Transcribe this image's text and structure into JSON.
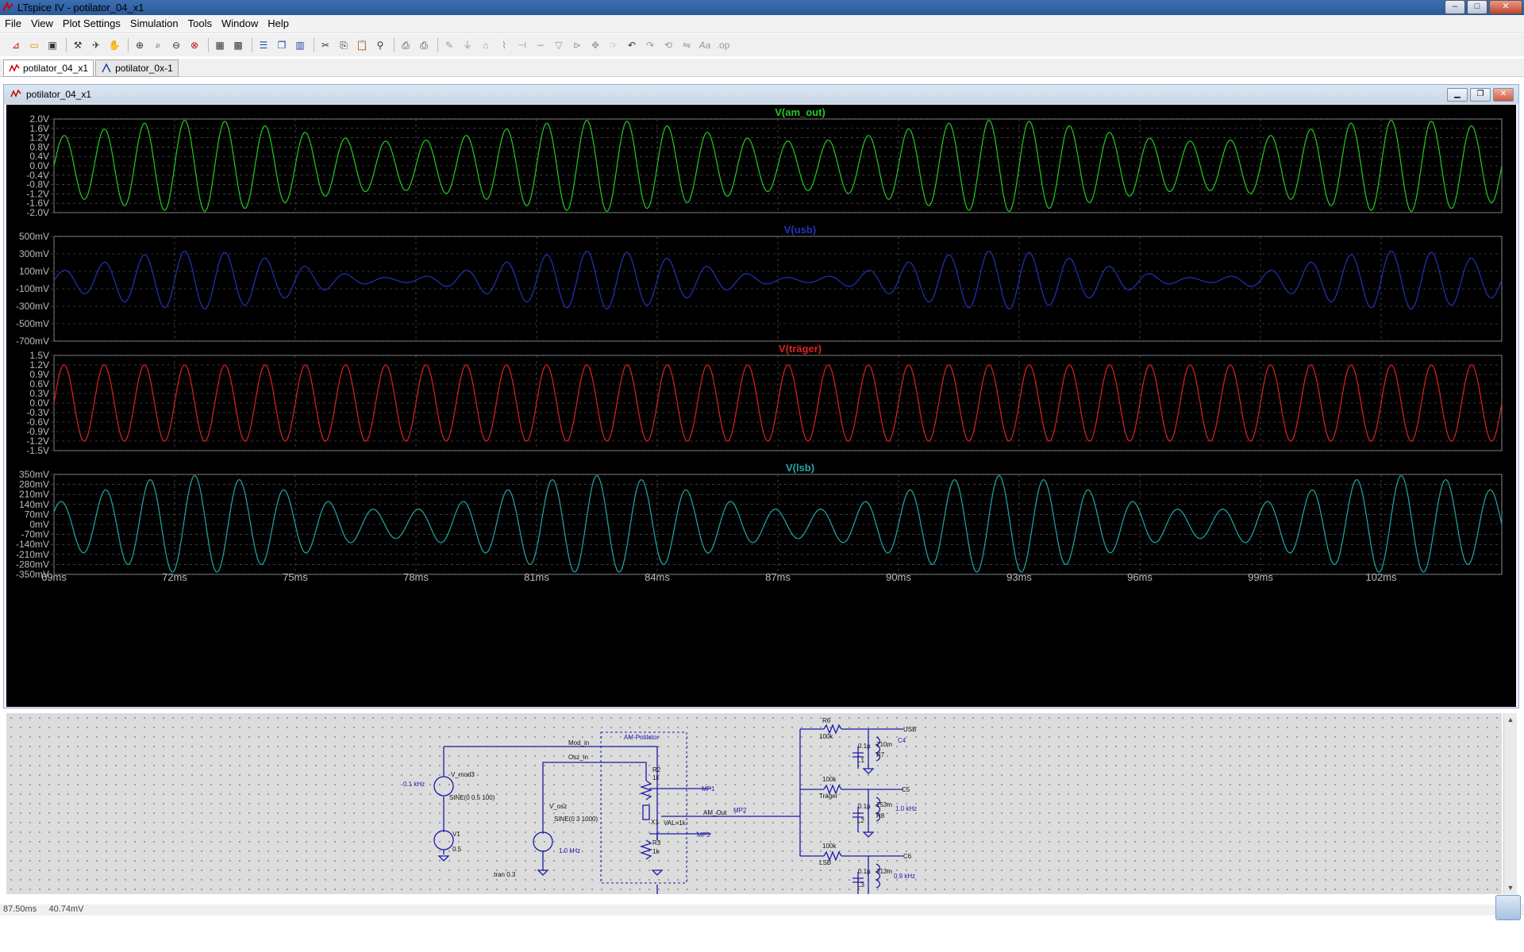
{
  "window": {
    "title": "LTspice IV - potilator_04_x1",
    "minimize": "–",
    "maximize": "□",
    "close": "✕"
  },
  "menu": [
    "File",
    "View",
    "Plot Settings",
    "Simulation",
    "Tools",
    "Window",
    "Help"
  ],
  "toolbar_icons": [
    "new-schematic-icon",
    "open-icon",
    "save-icon",
    "control-panel-icon",
    "run-icon",
    "pan-icon",
    "zoom-in-icon",
    "zoom-area-icon",
    "zoom-out-icon",
    "zoom-fit-icon",
    "autorange-icon",
    "mark-unused-icon",
    "tile-horizontal-icon",
    "cascade-icon",
    "tile-vertical-icon",
    "cut-icon",
    "copy-icon",
    "paste-icon",
    "find-icon",
    "print-setup-icon",
    "print-icon",
    "draw-wire-icon",
    "ground-icon",
    "label-icon",
    "resistor-icon",
    "capacitor-icon",
    "inductor-icon",
    "diode-icon",
    "component-icon",
    "move-icon",
    "drag-icon",
    "undo-icon",
    "redo-icon",
    "rotate-icon",
    "mirror-icon",
    "text-icon",
    "spice-directive-icon"
  ],
  "tabs": [
    {
      "label": "potilator_04_x1",
      "active": true
    },
    {
      "label": "potilator_0x-1",
      "active": false
    }
  ],
  "plot_window": {
    "title": "potilator_04_x1"
  },
  "x_axis": {
    "ticks": [
      "69ms",
      "72ms",
      "75ms",
      "78ms",
      "81ms",
      "84ms",
      "87ms",
      "90ms",
      "93ms",
      "96ms",
      "99ms",
      "102ms"
    ],
    "range_ms": [
      69,
      105
    ]
  },
  "chart_data": [
    {
      "type": "line",
      "title": "V(am_out)",
      "color": "#22cc22",
      "y_ticks": [
        "2.0V",
        "1.6V",
        "1.2V",
        "0.8V",
        "0.4V",
        "0.0V",
        "-0.4V",
        "-0.8V",
        "-1.2V",
        "-1.6V",
        "-2.0V"
      ],
      "ylim": [
        -2.0,
        2.0
      ],
      "series": [
        {
          "name": "V(am_out)",
          "carrier_freq_hz": 1000,
          "mod_freq_hz": 100,
          "amplitude": 1.5,
          "mod_depth": 0.3
        }
      ]
    },
    {
      "type": "line",
      "title": "V(usb)",
      "color": "#2233bb",
      "y_ticks": [
        "500mV",
        "300mV",
        "100mV",
        "-100mV",
        "-300mV",
        "-500mV",
        "-700mV"
      ],
      "ylim": [
        -0.7,
        0.5
      ],
      "series": [
        {
          "name": "V(usb)",
          "carrier_freq_hz": 1000,
          "mod_freq_hz": 100,
          "amplitude": 0.18,
          "mod_depth": 0.85
        }
      ]
    },
    {
      "type": "line",
      "title": "V(träger)",
      "color": "#dd2222",
      "y_ticks": [
        "1.5V",
        "1.2V",
        "0.9V",
        "0.6V",
        "0.3V",
        "0.0V",
        "-0.3V",
        "-0.6V",
        "-0.9V",
        "-1.2V",
        "-1.5V"
      ],
      "ylim": [
        -1.5,
        1.5
      ],
      "series": [
        {
          "name": "V(träger)",
          "carrier_freq_hz": 1000,
          "mod_freq_hz": 0,
          "amplitude": 1.2,
          "mod_depth": 0
        }
      ]
    },
    {
      "type": "line",
      "title": "V(lsb)",
      "color": "#22a8a8",
      "y_ticks": [
        "350mV",
        "280mV",
        "210mV",
        "140mV",
        "70mV",
        "0mV",
        "-70mV",
        "-140mV",
        "-210mV",
        "-280mV",
        "-350mV"
      ],
      "ylim": [
        -0.35,
        0.35
      ],
      "series": [
        {
          "name": "V(lsb)",
          "carrier_freq_hz": 900,
          "mod_freq_hz": 100,
          "amplitude": 0.22,
          "mod_depth": 0.55
        }
      ]
    }
  ],
  "schematic": {
    "labels": [
      {
        "id": "mod_in",
        "text": "Mod_in"
      },
      {
        "id": "osz_in",
        "text": "Osz_in"
      },
      {
        "id": "am_potilator",
        "text": "AM-Potilator"
      },
      {
        "id": "v_mod3",
        "text": "V_mod3"
      },
      {
        "id": "freq_01",
        "text": "0.1 kHz"
      },
      {
        "id": "sine_mod",
        "text": "SINE(0 0.5 100)"
      },
      {
        "id": "v1",
        "text": "V1"
      },
      {
        "id": "v1_val",
        "text": "0.5"
      },
      {
        "id": "v_osz",
        "text": "V_osz"
      },
      {
        "id": "sine_osz",
        "text": "SINE(0 3 1000)"
      },
      {
        "id": "freq_10",
        "text": "1.0 kHz"
      },
      {
        "id": "tran",
        "text": ".tran 0.3"
      },
      {
        "id": "r2",
        "text": "R2"
      },
      {
        "id": "r2_val",
        "text": "1k"
      },
      {
        "id": "x1",
        "text": "X1"
      },
      {
        "id": "val",
        "text": "VAL=1k"
      },
      {
        "id": "r3",
        "text": "R3"
      },
      {
        "id": "r3_val",
        "text": "1k"
      },
      {
        "id": "mp1",
        "text": "MP1"
      },
      {
        "id": "mp2",
        "text": "MP2"
      },
      {
        "id": "mp3",
        "text": "MP3"
      },
      {
        "id": "am_out",
        "text": "AM_Out"
      },
      {
        "id": "r6",
        "text": "R6"
      },
      {
        "id": "r6_val",
        "text": "100k"
      },
      {
        "id": "usb",
        "text": "USB"
      },
      {
        "id": "usb_f",
        "text": "1.1 KKhz"
      },
      {
        "id": "c4",
        "text": "C4"
      },
      {
        "id": "c4_val",
        "text": "0.1µ"
      },
      {
        "id": "l1",
        "text": "L1"
      },
      {
        "id": "l1_val",
        "text": "210m"
      },
      {
        "id": "r7",
        "text": "R7"
      },
      {
        "id": "r7_val",
        "text": "100k"
      },
      {
        "id": "trager",
        "text": "Träger"
      },
      {
        "id": "c5",
        "text": "C5"
      },
      {
        "id": "c5_val",
        "text": "0.1µ"
      },
      {
        "id": "l2",
        "text": "L2"
      },
      {
        "id": "l2_val",
        "text": "253m"
      },
      {
        "id": "trager_f",
        "text": "1.0 kHz"
      },
      {
        "id": "r8",
        "text": "R8"
      },
      {
        "id": "r8_val",
        "text": "100k"
      },
      {
        "id": "lsb",
        "text": "LSB"
      },
      {
        "id": "c6",
        "text": "C6"
      },
      {
        "id": "c6_val",
        "text": "0.1µ"
      },
      {
        "id": "l3",
        "text": "L3"
      },
      {
        "id": "l3_val",
        "text": "313m"
      },
      {
        "id": "lsb_f",
        "text": "0.9 kHz"
      }
    ]
  },
  "status": {
    "cursor_x": "87.50ms",
    "cursor_y": "40.74mV"
  }
}
